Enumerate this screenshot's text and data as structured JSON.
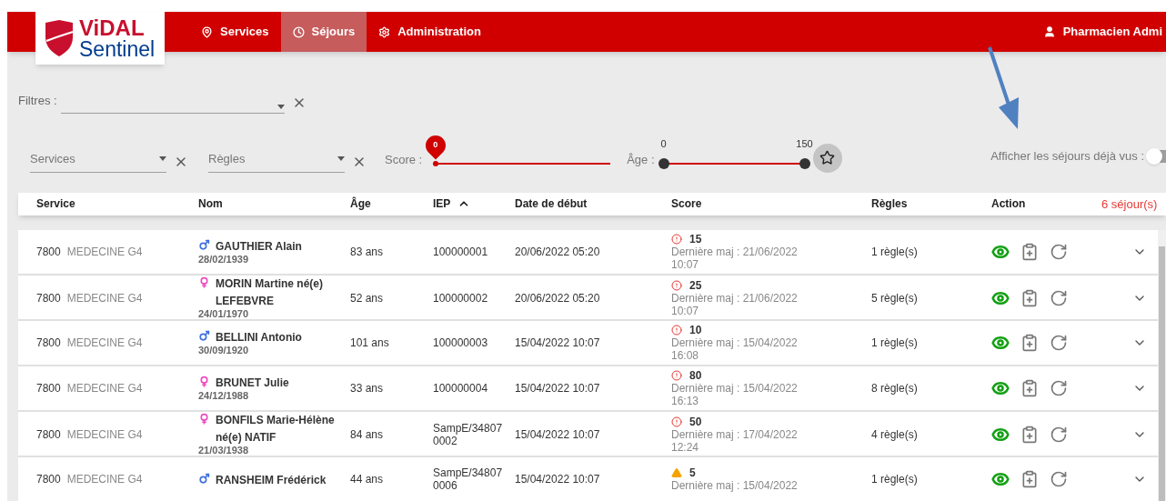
{
  "logo": {
    "line1": "ViDAL",
    "line2": "Sentinel"
  },
  "nav": [
    {
      "label": "Services",
      "selected": false
    },
    {
      "label": "Séjours",
      "selected": true
    },
    {
      "label": "Administration",
      "selected": false
    }
  ],
  "user": {
    "name": "Pharmacien Admi"
  },
  "filters": {
    "label": "Filtres :",
    "services": {
      "placeholder": "Services"
    },
    "rules": {
      "placeholder": "Règles"
    },
    "score": {
      "label": "Score :",
      "bubble": "0",
      "level": 0
    },
    "age": {
      "label": "Âge :",
      "thumbs": [
        {
          "label": "0",
          "level": 0
        },
        {
          "label": "150",
          "level": 1
        }
      ]
    },
    "seen_toggle": {
      "label": "Afficher les séjours déjà vus :",
      "on": false
    }
  },
  "table": {
    "columns": [
      {
        "label": "Service",
        "sorted": false
      },
      {
        "label": "Nom",
        "sorted": false
      },
      {
        "label": "Âge",
        "sorted": false
      },
      {
        "label": "IEP",
        "sorted": true
      },
      {
        "label": "Date de début",
        "sorted": false
      },
      {
        "label": "Score",
        "sorted": false
      },
      {
        "label": "Règles",
        "sorted": false
      },
      {
        "label": "Action",
        "sorted": false
      }
    ],
    "count": "6 séjour(s)",
    "rows": [
      {
        "code": "7800",
        "service": "MEDECINE G4",
        "patient": {
          "kind": "male",
          "name": "GAUTHIER Alain",
          "birth": "28/02/1939"
        },
        "age": "83 ans",
        "iep": "100000001",
        "start": "20/06/2022 05:20",
        "score": {
          "kind": "alert",
          "value": "15",
          "updated": "Dernière maj : 21/06/2022",
          "time": "10:07"
        },
        "rules": "1 règle(s)"
      },
      {
        "code": "7800",
        "service": "MEDECINE G4",
        "patient": {
          "kind": "female",
          "name": "MORIN Martine né(e) LEFEBVRE",
          "birth": "24/01/1970"
        },
        "age": "52 ans",
        "iep": "100000002",
        "start": "20/06/2022 05:20",
        "score": {
          "kind": "alert",
          "value": "25",
          "updated": "Dernière maj : 21/06/2022",
          "time": "10:07"
        },
        "rules": "5 règle(s)"
      },
      {
        "code": "7800",
        "service": "MEDECINE G4",
        "patient": {
          "kind": "male",
          "name": "BELLINI Antonio",
          "birth": "30/09/1920"
        },
        "age": "101 ans",
        "iep": "100000003",
        "start": "15/04/2022 10:07",
        "score": {
          "kind": "alert",
          "value": "10",
          "updated": "Dernière maj : 15/04/2022",
          "time": "16:08"
        },
        "rules": "1 règle(s)"
      },
      {
        "code": "7800",
        "service": "MEDECINE G4",
        "patient": {
          "kind": "female",
          "name": "BRUNET Julie",
          "birth": "24/12/1988"
        },
        "age": "33 ans",
        "iep": "100000004",
        "start": "15/04/2022 10:07",
        "score": {
          "kind": "alert",
          "value": "80",
          "updated": "Dernière maj : 15/04/2022",
          "time": "16:13"
        },
        "rules": "8 règle(s)"
      },
      {
        "code": "7800",
        "service": "MEDECINE G4",
        "patient": {
          "kind": "female",
          "name": "BONFILS Marie-Hélène né(e) NATIF",
          "birth": "21/03/1938"
        },
        "age": "84 ans",
        "iep": "SampE/348070002",
        "start": "15/04/2022 10:07",
        "score": {
          "kind": "alert",
          "value": "50",
          "updated": "Dernière maj : 17/04/2022",
          "time": "12:24"
        },
        "rules": "4 règle(s)"
      },
      {
        "code": "7800",
        "service": "MEDECINE G4",
        "patient": {
          "kind": "male",
          "name": "RANSHEIM Frédérick"
        },
        "age": "44 ans",
        "iep": "SampE/348070006",
        "start": "15/04/2022 10:07",
        "score": {
          "kind": "warning",
          "value": "5",
          "updated": "Dernière maj : 15/04/2022"
        },
        "rules": "1 règle(s)"
      }
    ]
  }
}
